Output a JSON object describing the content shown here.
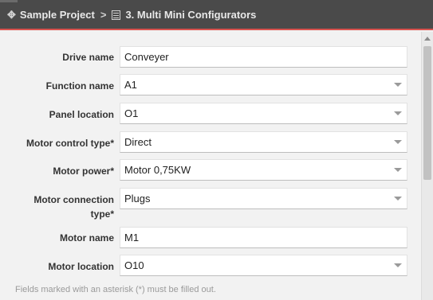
{
  "header": {
    "project": "Sample Project",
    "separator": ">",
    "page": "3. Multi Mini Configurators",
    "accent_color": "#d9534f"
  },
  "form": {
    "fields": [
      {
        "label": "Drive name",
        "value": "Conveyer",
        "type": "text"
      },
      {
        "label": "Function name",
        "value": "A1",
        "type": "select"
      },
      {
        "label": "Panel location",
        "value": "O1",
        "type": "select"
      },
      {
        "label": "Motor control type*",
        "value": "Direct",
        "type": "select"
      },
      {
        "label": "Motor power*",
        "value": "Motor 0,75KW",
        "type": "select"
      },
      {
        "label_line1": "Motor connection",
        "label_line2": "type*",
        "value": "Plugs",
        "type": "select"
      },
      {
        "label": "Motor name",
        "value": "M1",
        "type": "text"
      },
      {
        "label": "Motor location",
        "value": "O10",
        "type": "select"
      }
    ],
    "footnote": "Fields marked with an asterisk (*) must be filled out."
  }
}
